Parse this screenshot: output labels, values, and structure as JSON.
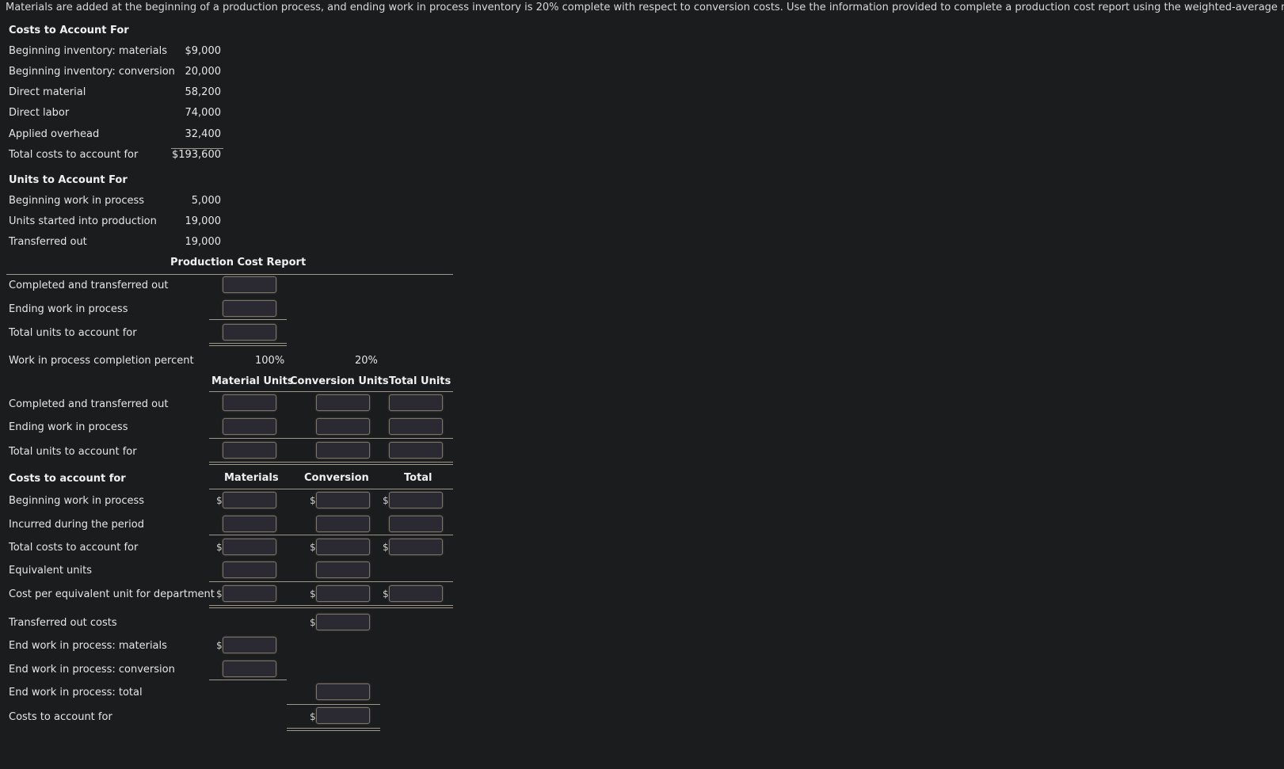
{
  "intro": "Materials are added at the beginning of a production process, and ending work in process inventory is 20% complete with respect to conversion costs. Use the information provided to complete a production cost report using the weighted-average method.",
  "costs_section": {
    "title": "Costs to Account For",
    "rows": [
      {
        "label": "Beginning inventory: materials",
        "value": "$9,000"
      },
      {
        "label": "Beginning inventory: conversion",
        "value": "20,000"
      },
      {
        "label": "Direct material",
        "value": "58,200"
      },
      {
        "label": "Direct labor",
        "value": "74,000"
      },
      {
        "label": "Applied overhead",
        "value": "32,400"
      },
      {
        "label": "Total costs to account for",
        "value": "$193,600"
      }
    ]
  },
  "units_section": {
    "title": "Units to Account For",
    "rows": [
      {
        "label": "Beginning work in process",
        "value": "5,000"
      },
      {
        "label": "Units started into production",
        "value": "19,000"
      },
      {
        "label": "Transferred out",
        "value": "19,000"
      }
    ]
  },
  "report": {
    "title": "Production Cost Report",
    "units_rows": [
      "Completed and transferred out",
      "Ending work in process",
      "Total units to account for"
    ],
    "completion_label": "Work in process completion percent",
    "completion_material": "100%",
    "completion_conversion": "20%",
    "eq_headers": [
      "Material Units",
      "Conversion Units",
      "Total Units"
    ],
    "eq_rows": [
      "Completed and transferred out",
      "Ending work in process",
      "Total units to account for"
    ],
    "cost_header": "Costs to account for",
    "cost_col_headers": [
      "Materials",
      "Conversion",
      "Total"
    ],
    "cost_rows": [
      "Beginning work in process",
      "Incurred during the period",
      "Total costs to account for",
      "Equivalent units",
      "Cost per equivalent unit for department"
    ],
    "final_rows": [
      "Transferred out costs",
      "End work in process: materials",
      "End work in process: conversion",
      "End work in process: total",
      "Costs to account for"
    ],
    "currency_symbol": "$",
    "inputs": {}
  }
}
